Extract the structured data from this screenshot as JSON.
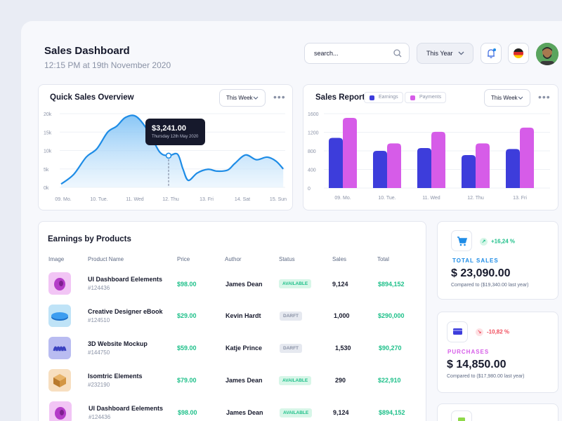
{
  "header": {
    "title": "Sales Dashboard",
    "subtitle": "12:15 PM at 19th November 2020",
    "search_placeholder": "search...",
    "period_select": "This Year"
  },
  "quick_sales": {
    "title": "Quick Sales Overview",
    "range_select": "This Week",
    "tooltip_value": "$3,241.00",
    "tooltip_date": "Thursday 12th May 2020",
    "y_ticks": [
      "20k",
      "15k",
      "10k",
      "5k",
      "0k"
    ],
    "x_ticks": [
      "09. Mo.",
      "10. Tue.",
      "11. Wed",
      "12. Thu",
      "13. Fri",
      "14. Sat",
      "15. Sun"
    ]
  },
  "sales_report": {
    "title": "Sales Report",
    "legend_earnings": "Earnings",
    "legend_payments": "Payments",
    "range_select": "This Week",
    "y_ticks": [
      "1600",
      "1200",
      "800",
      "400",
      "0"
    ],
    "x_ticks": [
      "09. Mo.",
      "10. Tue.",
      "11. Wed",
      "12. Thu",
      "13. Fri"
    ]
  },
  "chart_data": [
    {
      "type": "area",
      "title": "Quick Sales Overview",
      "x": [
        "09. Mo.",
        "10. Tue.",
        "11. Wed",
        "12. Thu",
        "13. Fri",
        "14. Sat",
        "15. Sun"
      ],
      "y_ticks": [
        "20k",
        "15k",
        "10k",
        "5k",
        "0k"
      ],
      "ylim": [
        0,
        20000
      ],
      "points": [
        [
          0,
          900
        ],
        [
          0.35,
          3500
        ],
        [
          0.7,
          8200
        ],
        [
          1,
          10500
        ],
        [
          1.3,
          15000
        ],
        [
          1.55,
          16600
        ],
        [
          1.8,
          19000
        ],
        [
          2.1,
          19200
        ],
        [
          2.45,
          15000
        ],
        [
          2.75,
          9600
        ],
        [
          3,
          8600
        ],
        [
          3.25,
          9000
        ],
        [
          3.4,
          5000
        ],
        [
          3.55,
          1900
        ],
        [
          3.8,
          3900
        ],
        [
          4.1,
          4900
        ],
        [
          4.35,
          4400
        ],
        [
          4.65,
          4700
        ],
        [
          4.85,
          6500
        ],
        [
          5.15,
          8800
        ],
        [
          5.45,
          7500
        ],
        [
          5.75,
          8200
        ],
        [
          6,
          7100
        ],
        [
          6.2,
          5000
        ]
      ],
      "highlight": {
        "x": 3,
        "value": 3241,
        "label": "$3,241.00",
        "date": "Thursday 12th May 2020"
      },
      "grid": true
    },
    {
      "type": "bar",
      "title": "Sales Report",
      "categories": [
        "09. Mo.",
        "10. Tue.",
        "11. Wed",
        "12. Thu",
        "13. Fri"
      ],
      "series": [
        {
          "name": "Earnings",
          "values": [
            1080,
            800,
            860,
            710,
            840
          ]
        },
        {
          "name": "Payments",
          "values": [
            1510,
            960,
            1210,
            960,
            1300
          ]
        }
      ],
      "y_ticks": [
        "1600",
        "1200",
        "800",
        "400",
        "0"
      ],
      "ylim": [
        0,
        1600
      ],
      "legend": "top",
      "grid": true
    }
  ],
  "products": {
    "title": "Earnings by Products",
    "columns": [
      "Image",
      "Product Name",
      "Price",
      "Author",
      "Status",
      "Sales",
      "Total"
    ],
    "rows": [
      {
        "name": "UI Dashboard Eelements",
        "id": "#124436",
        "price": "$98.00",
        "author": "James Dean",
        "status": "AVAILABLE",
        "sales": "9,124",
        "total": "$894,152"
      },
      {
        "name": "Creative Designer eBook",
        "id": "#124510",
        "price": "$29.00",
        "author": "Kevin Hardt",
        "status": "DARFT",
        "sales": "1,000",
        "total": "$290,000"
      },
      {
        "name": "3D Website Mockup",
        "id": "#144750",
        "price": "$59.00",
        "author": "Katje Prince",
        "status": "DARFT",
        "sales": "1,530",
        "total": "$90,270"
      },
      {
        "name": "Isomtric Elements",
        "id": "#232190",
        "price": "$79.00",
        "author": "James Dean",
        "status": "AVAILABLE",
        "sales": "290",
        "total": "$22,910"
      },
      {
        "name": "UI Dashboard Eelements",
        "id": "#124436",
        "price": "$98.00",
        "author": "James Dean",
        "status": "AVAILABLE",
        "sales": "9,124",
        "total": "$894,152"
      }
    ]
  },
  "stats": {
    "total_sales": {
      "trend": "+16,24 %",
      "label": "TOTAL SALES",
      "value": "$ 23,090.00",
      "compare": "Compared to ($19,340.00 last year)"
    },
    "purchases": {
      "trend": "-10,82 %",
      "label": "PURCHASES",
      "value": "$ 14,850.00",
      "compare": "Compared to ($17,980.00 last year)"
    }
  },
  "colors": {
    "earnings": "#3d3ddb",
    "payments": "#d65ce8",
    "line": "#1e8ce6",
    "positive": "#1fc08a",
    "negative": "#f04d5d"
  },
  "icons": {
    "search": "search-icon",
    "chevron": "chevron-down-icon",
    "bell": "bell-icon",
    "flag": "german-flag-icon",
    "cart": "cart-icon",
    "card": "credit-card-icon"
  }
}
